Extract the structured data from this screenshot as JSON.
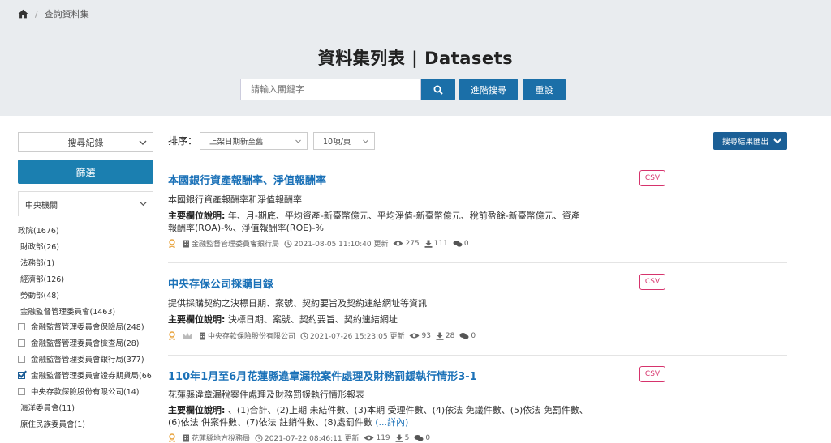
{
  "breadcrumb": {
    "current": "查詢資料集"
  },
  "header": {
    "title": "資料集列表 | Datasets",
    "search_placeholder": "請輸入關鍵字",
    "advanced_label": "進階搜尋",
    "reset_label": "重設"
  },
  "sidebar": {
    "history_label": "搜尋紀錄",
    "filter_label": "篩選",
    "panel_label": "中央機關",
    "items": [
      {
        "label": "政院(1676)"
      },
      {
        "label": "財政部(26)"
      },
      {
        "label": "法務部(1)"
      },
      {
        "label": "經濟部(126)"
      },
      {
        "label": "勞動部(48)"
      },
      {
        "label": "金融監督管理委員會(1463)"
      },
      {
        "label": "金融監督管理委員會保險局(248)",
        "checked": false
      },
      {
        "label": "金融監督管理委員會檢查局(28)",
        "checked": false
      },
      {
        "label": "金融監督管理委員會銀行局(377)",
        "checked": false
      },
      {
        "label": "金融監督管理委員會證券期貨局(66",
        "checked": true
      },
      {
        "label": "中央存款保險股份有限公司(14)",
        "checked": false
      },
      {
        "label": "海洋委員會(11)"
      },
      {
        "label": "原住民族委員會(1)"
      }
    ]
  },
  "toolbar": {
    "sort_label": "排序：",
    "sort_value": "上架日期新至舊",
    "page_size_value": "10項/頁",
    "export_label": "搜尋結果匯出"
  },
  "datasets": [
    {
      "title": "本國銀行資產報酬率、淨值報酬率",
      "format": "CSV",
      "description": "本國銀行資產報酬率和淨值報酬率",
      "fields_label": "主要欄位說明:",
      "fields_line1": " 年、月-期底、平均資產-新臺幣億元、平均淨值-新臺幣億元、稅前盈餘-新臺幣億元、資產",
      "fields_line2": "報酬率(ROA)-%、淨值報酬率(ROE)-%",
      "fields_more": "",
      "agency": "金融監督管理委員會銀行局",
      "updated": "2021-08-05 11:10:40 更新",
      "views": "275",
      "downloads": "111",
      "comments": "0"
    },
    {
      "title": "中央存保公司採購目錄",
      "format": "CSV",
      "description": "提供採購契約之決標日期、案號、契約要旨及契約連結網址等資訊",
      "fields_label": "主要欄位說明:",
      "fields_line1": " 決標日期、案號、契約要旨、契約連結網址",
      "fields_line2": "",
      "fields_more": "",
      "agency": "中央存款保險股份有限公司",
      "updated": "2021-07-26 15:23:05 更新",
      "views": "93",
      "downloads": "28",
      "comments": "0"
    },
    {
      "title": "110年1月至6月花蓮縣違章漏稅案件處理及財務罰鍰執行情形3-1",
      "format": "CSV",
      "description": "花蓮縣違章漏稅案件處理及財務罰鍰執行情形報表",
      "fields_label": "主要欄位說明:",
      "fields_line1": " 、(1)合計、(2)上期 未結件數、(3)本期 受理件數、(4)依法 免議件數、(5)依法 免罰件數、",
      "fields_line2": "(6)依法 併案件數、(7)依法 註銷件數、(8)處罰件數 ",
      "fields_more": "(...詳內)",
      "agency": "花蓮縣地方稅務局",
      "updated": "2021-07-22 08:46:11 更新",
      "views": "119",
      "downloads": "5",
      "comments": "0"
    }
  ],
  "colors": {
    "accent": "#1b6fa8",
    "csv_badge": "#d6336c",
    "title_link": "#1c72b8"
  },
  "icons": [
    "home-icon",
    "search-icon",
    "chevron-down-icon",
    "award-icon",
    "building-icon",
    "clock-icon",
    "eye-icon",
    "download-icon",
    "comments-icon",
    "check-icon"
  ]
}
